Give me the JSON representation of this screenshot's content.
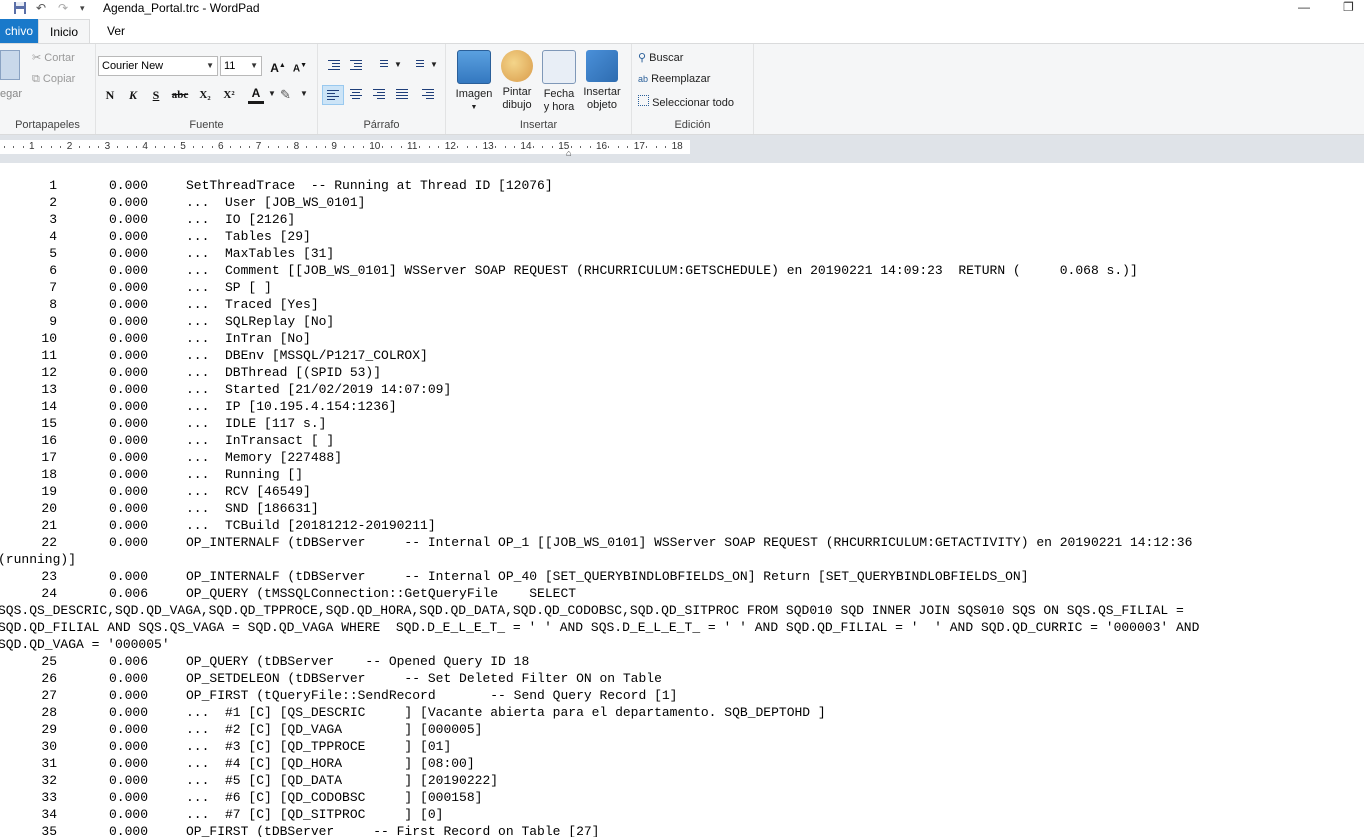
{
  "window": {
    "title": "Agenda_Portal.trc - WordPad"
  },
  "ribbon_tabs": [
    "chivo",
    "Inicio",
    "Ver"
  ],
  "clipboard": {
    "paste_label": "egar",
    "cut_label": "Cortar",
    "copy_label": "Copiar",
    "group_label": "Portapapeles"
  },
  "font": {
    "family": "Courier New",
    "size": "11",
    "group_label": "Fuente",
    "bold": "N",
    "italic": "K",
    "underline": "S",
    "strike": "abc",
    "subscript": "X₂",
    "superscript": "X²",
    "color": "A"
  },
  "paragraph": {
    "group_label": "Párrafo"
  },
  "insert": {
    "image": "Imagen",
    "paint_line1": "Pintar",
    "paint_line2": "dibujo",
    "datetime_line1": "Fecha",
    "datetime_line2": "y hora",
    "object_line1": "Insertar",
    "object_line2": "objeto",
    "group_label": "Insertar"
  },
  "editing": {
    "find": "Buscar",
    "replace": "Reemplazar",
    "select_all": "Seleccionar todo",
    "group_label": "Edición"
  },
  "ruler": {
    "numbers": [
      "1",
      "2",
      "3",
      "4",
      "5",
      "6",
      "7",
      "8",
      "9",
      "10",
      "11",
      "12",
      "13",
      "14",
      "15",
      "16",
      "17",
      "18"
    ]
  },
  "document": {
    "rows": [
      {
        "n": "1",
        "v": "0.000",
        "t": "SetThreadTrace  -- Running at Thread ID [12076]"
      },
      {
        "n": "2",
        "v": "0.000",
        "t": "...  User [JOB_WS_0101]"
      },
      {
        "n": "3",
        "v": "0.000",
        "t": "...  IO [2126]"
      },
      {
        "n": "4",
        "v": "0.000",
        "t": "...  Tables [29]"
      },
      {
        "n": "5",
        "v": "0.000",
        "t": "...  MaxTables [31]"
      },
      {
        "n": "6",
        "v": "0.000",
        "t": "...  Comment [[JOB_WS_0101] WSServer SOAP REQUEST (RHCURRICULUM:GETSCHEDULE) en 20190221 14:09:23  RETURN (     0.068 s.)]"
      },
      {
        "n": "7",
        "v": "0.000",
        "t": "...  SP [ ]"
      },
      {
        "n": "8",
        "v": "0.000",
        "t": "...  Traced [Yes]"
      },
      {
        "n": "9",
        "v": "0.000",
        "t": "...  SQLReplay [No]"
      },
      {
        "n": "10",
        "v": "0.000",
        "t": "...  InTran [No]"
      },
      {
        "n": "11",
        "v": "0.000",
        "t": "...  DBEnv [MSSQL/P1217_COLROX]"
      },
      {
        "n": "12",
        "v": "0.000",
        "t": "...  DBThread [(SPID 53)]"
      },
      {
        "n": "13",
        "v": "0.000",
        "t": "...  Started [21/02/2019 14:07:09]"
      },
      {
        "n": "14",
        "v": "0.000",
        "t": "...  IP [10.195.4.154:1236]"
      },
      {
        "n": "15",
        "v": "0.000",
        "t": "...  IDLE [117 s.]"
      },
      {
        "n": "16",
        "v": "0.000",
        "t": "...  InTransact [ ]"
      },
      {
        "n": "17",
        "v": "0.000",
        "t": "...  Memory [227488]"
      },
      {
        "n": "18",
        "v": "0.000",
        "t": "...  Running []"
      },
      {
        "n": "19",
        "v": "0.000",
        "t": "...  RCV [46549]"
      },
      {
        "n": "20",
        "v": "0.000",
        "t": "...  SND [186631]"
      },
      {
        "n": "21",
        "v": "0.000",
        "t": "...  TCBuild [20181212-20190211]"
      },
      {
        "n": "22",
        "v": "0.000",
        "t": "OP_INTERNALF (tDBServer     -- Internal OP_1 [[JOB_WS_0101] WSServer SOAP REQUEST (RHCURRICULUM:GETACTIVITY) en 20190221 14:12:36"
      },
      {
        "w": "(running)]"
      },
      {
        "n": "23",
        "v": "0.000",
        "t": "OP_INTERNALF (tDBServer     -- Internal OP_40 [SET_QUERYBINDLOBFIELDS_ON] Return [SET_QUERYBINDLOBFIELDS_ON]"
      },
      {
        "n": "24",
        "v": "0.006",
        "t": "OP_QUERY (tMSSQLConnection::GetQueryFile    SELECT"
      },
      {
        "w": "SQS.QS_DESCRIC,SQD.QD_VAGA,SQD.QD_TPPROCE,SQD.QD_HORA,SQD.QD_DATA,SQD.QD_CODOBSC,SQD.QD_SITPROC FROM SQD010 SQD INNER JOIN SQS010 SQS ON SQS.QS_FILIAL ="
      },
      {
        "w": "SQD.QD_FILIAL AND SQS.QS_VAGA = SQD.QD_VAGA WHERE  SQD.D_E_L_E_T_ = ' ' AND SQS.D_E_L_E_T_ = ' ' AND SQD.QD_FILIAL = '  ' AND SQD.QD_CURRIC = '000003' AND"
      },
      {
        "w": "SQD.QD_VAGA = '000005'"
      },
      {
        "n": "25",
        "v": "0.006",
        "t": "OP_QUERY (tDBServer    -- Opened Query ID 18"
      },
      {
        "n": "26",
        "v": "0.000",
        "t": "OP_SETDELEON (tDBServer     -- Set Deleted Filter ON on Table"
      },
      {
        "n": "27",
        "v": "0.000",
        "t": "OP_FIRST (tQueryFile::SendRecord       -- Send Query Record [1]"
      },
      {
        "n": "28",
        "v": "0.000",
        "t": "...  #1 [C] [QS_DESCRIC     ] [Vacante abierta para el departamento. SQB_DEPTOHD ]"
      },
      {
        "n": "29",
        "v": "0.000",
        "t": "...  #2 [C] [QD_VAGA        ] [000005]"
      },
      {
        "n": "30",
        "v": "0.000",
        "t": "...  #3 [C] [QD_TPPROCE     ] [01]"
      },
      {
        "n": "31",
        "v": "0.000",
        "t": "...  #4 [C] [QD_HORA        ] [08:00]"
      },
      {
        "n": "32",
        "v": "0.000",
        "t": "...  #5 [C] [QD_DATA        ] [20190222]"
      },
      {
        "n": "33",
        "v": "0.000",
        "t": "...  #6 [C] [QD_CODOBSC     ] [000158]"
      },
      {
        "n": "34",
        "v": "0.000",
        "t": "...  #7 [C] [QD_SITPROC     ] [0]"
      },
      {
        "n": "35",
        "v": "0.000",
        "t": "OP_FIRST (tDBServer     -- First Record on Table [27]"
      }
    ]
  }
}
